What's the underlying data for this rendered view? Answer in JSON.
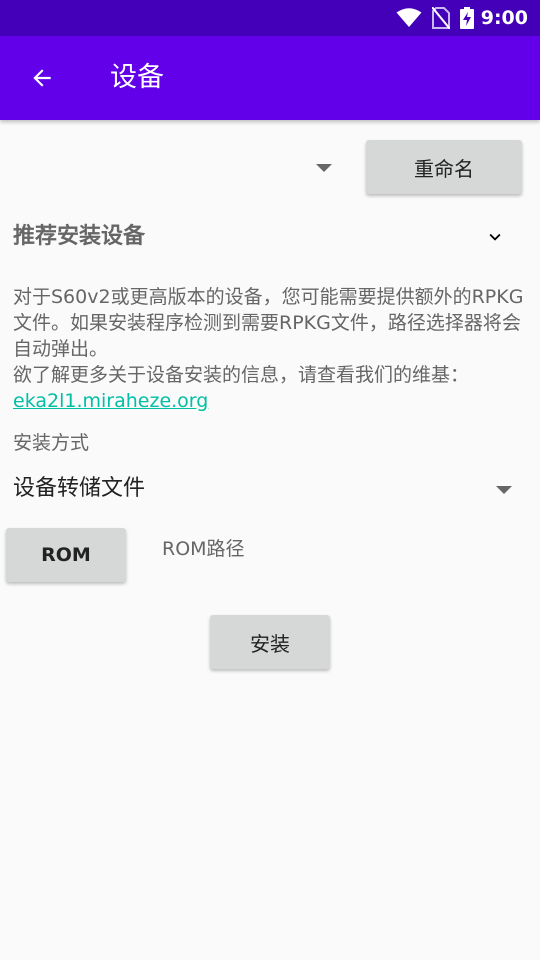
{
  "status_bar": {
    "time": "9:00",
    "icons": [
      "wifi-icon",
      "no-sim-icon",
      "battery-charging-icon"
    ]
  },
  "app_bar": {
    "title": "设备",
    "back_icon": "arrow-left-icon"
  },
  "device_selector": {
    "value": "",
    "rename_label": "重命名"
  },
  "recommended": {
    "title": "推荐安装设备",
    "expand_icon": "chevron-down-icon",
    "description_line1": "对于S60v2或更高版本的设备，您可能需要提供额外的RPKG文件。如果安装程序检测到需要RPKG文件，路径选择器将会自动弹出。",
    "description_line2_prefix": "欲了解更多关于设备安装的信息，请查看我们的维基：",
    "wiki_link": "eka2l1.miraheze.org"
  },
  "install_method": {
    "label": "安装方式",
    "selected": "设备转储文件"
  },
  "rom": {
    "button_label": "ROM",
    "path_label": "ROM路径"
  },
  "install_button_label": "安装",
  "colors": {
    "status_bar": "#4400b8",
    "app_bar": "#6200ea",
    "link": "#00bfa5",
    "button": "#d6d7d7"
  }
}
